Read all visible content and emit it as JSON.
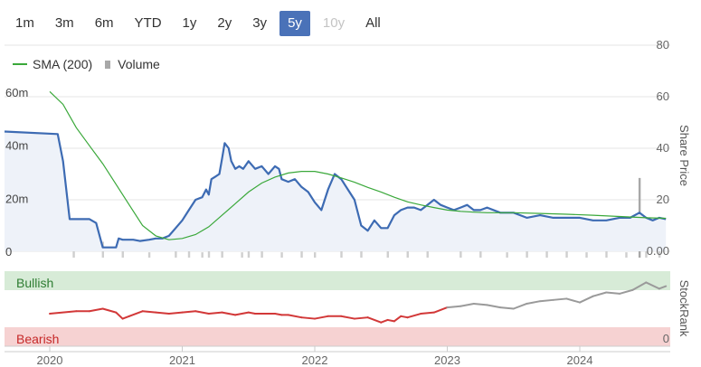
{
  "range_selector": {
    "buttons": [
      {
        "label": "1m",
        "state": "normal"
      },
      {
        "label": "3m",
        "state": "normal"
      },
      {
        "label": "6m",
        "state": "normal"
      },
      {
        "label": "YTD",
        "state": "normal"
      },
      {
        "label": "1y",
        "state": "normal"
      },
      {
        "label": "2y",
        "state": "normal"
      },
      {
        "label": "3y",
        "state": "normal"
      },
      {
        "label": "5y",
        "state": "active"
      },
      {
        "label": "10y",
        "state": "disabled"
      },
      {
        "label": "All",
        "state": "normal"
      }
    ]
  },
  "legend": {
    "sma_label": "SMA (200)",
    "volume_label": "Volume"
  },
  "colors": {
    "price_line": "#3d6bb3",
    "price_fill": "#eef2f9",
    "sma_line": "#3aa83a",
    "volume_bar": "#cfcfcf",
    "volume_spike": "#a8a8a8",
    "bullish_fill": "#d7ebd7",
    "bearish_fill": "#f6d2d2",
    "bullish_text": "#2e7d32",
    "bearish_text": "#c62828",
    "rank_red": "#d23838",
    "rank_grey": "#9a9a9a",
    "active_button": "#4a72b8"
  },
  "chart_data": {
    "type": "line",
    "x_labels": [
      "2020",
      "2021",
      "2022",
      "2023",
      "2024"
    ],
    "price_axis": {
      "title": "Share Price",
      "ticks": [
        "80",
        "60",
        "40",
        "20",
        "0.00"
      ],
      "ylim": [
        0,
        80
      ]
    },
    "volume_axis": {
      "ticks": [
        "60m",
        "40m",
        "20m",
        "0"
      ],
      "ylim": [
        0,
        80
      ]
    },
    "rank_axis": {
      "title": "StockRank",
      "ticks": [
        "0"
      ]
    },
    "zones": {
      "bullish_label": "Bullish",
      "bearish_label": "Bearish"
    },
    "series": [
      {
        "name": "Share Price",
        "x": [
          0,
          0.06,
          0.1,
          0.15,
          0.2,
          0.22,
          0.25,
          0.3,
          0.35,
          0.4,
          0.5,
          0.52,
          0.55,
          0.6,
          0.63,
          0.68,
          0.75,
          0.8,
          0.85,
          0.9,
          0.95,
          1.0,
          1.05,
          1.1,
          1.15,
          1.18,
          1.2,
          1.22,
          1.25,
          1.28,
          1.3,
          1.32,
          1.35,
          1.37,
          1.4,
          1.43,
          1.46,
          1.5,
          1.55,
          1.6,
          1.65,
          1.7,
          1.73,
          1.75,
          1.8,
          1.85,
          1.9,
          1.95,
          2.0,
          2.05,
          2.1,
          2.15,
          2.2,
          2.25,
          2.3,
          2.35,
          2.4,
          2.45,
          2.5,
          2.55,
          2.6,
          2.65,
          2.7,
          2.75,
          2.8,
          2.85,
          2.9,
          2.95,
          3.0,
          3.05,
          3.1,
          3.15,
          3.2,
          3.25,
          3.3,
          3.4,
          3.5,
          3.6,
          3.7,
          3.8,
          3.9,
          4.0,
          4.1,
          4.2,
          4.3,
          4.38,
          4.45,
          4.5,
          4.55,
          4.6,
          4.65
        ],
        "values": [
          46.5,
          45.5,
          35,
          12.5,
          12.5,
          12.5,
          12.5,
          12.5,
          11,
          1.5,
          1.5,
          5,
          4.5,
          4.5,
          4.5,
          4,
          4.5,
          5,
          5,
          6,
          9,
          12,
          16,
          20,
          21,
          24,
          22,
          28,
          29,
          30,
          36,
          42,
          40,
          35,
          32,
          33,
          32,
          35,
          32,
          33,
          30,
          33,
          32,
          28,
          27,
          28,
          25,
          23,
          19,
          16,
          24,
          30,
          28,
          24,
          20,
          10,
          8,
          12,
          9,
          9,
          14,
          16,
          17,
          17,
          16,
          18,
          20,
          18,
          17,
          16,
          17,
          18,
          16,
          16,
          17,
          15,
          15,
          13,
          14,
          13,
          13,
          13,
          12,
          12,
          13,
          13,
          15,
          13,
          12,
          13,
          12.5
        ]
      },
      {
        "name": "SMA (200)",
        "x": [
          0,
          0.1,
          0.2,
          0.3,
          0.4,
          0.5,
          0.6,
          0.7,
          0.8,
          0.9,
          1.0,
          1.1,
          1.2,
          1.3,
          1.4,
          1.5,
          1.6,
          1.7,
          1.8,
          1.9,
          2.0,
          2.1,
          2.2,
          2.3,
          2.4,
          2.5,
          2.6,
          2.7,
          2.8,
          2.9,
          3.0,
          3.1,
          3.2,
          3.3,
          3.5,
          3.7,
          3.9,
          4.1,
          4.3,
          4.5,
          4.65
        ],
        "values": [
          62,
          57,
          48,
          41,
          34,
          26,
          18,
          10,
          6,
          4.5,
          5,
          6.5,
          9.5,
          14,
          18.5,
          23,
          26.5,
          28.8,
          30.4,
          31,
          31,
          30,
          28.5,
          26.8,
          24.8,
          23,
          21,
          19.2,
          18,
          17,
          16,
          15.5,
          15.2,
          15,
          15,
          14.7,
          14.4,
          14,
          13.5,
          13,
          12.8
        ]
      },
      {
        "name": "Volume",
        "x": [
          0.18,
          0.4,
          0.55,
          0.75,
          0.95,
          1.05,
          1.15,
          1.2,
          1.3,
          1.45,
          1.5,
          1.6,
          1.75,
          1.9,
          2.0,
          2.2,
          2.35,
          2.55,
          2.7,
          2.85,
          3.1,
          3.25,
          3.45,
          3.6,
          3.75,
          3.9,
          4.05,
          4.2,
          4.35,
          4.45,
          4.5,
          4.6
        ],
        "values": [
          4,
          6,
          3,
          2,
          4,
          3,
          2,
          5,
          3,
          2,
          4,
          3,
          2,
          3,
          2,
          5,
          4,
          6,
          3,
          5,
          3,
          4,
          2,
          3,
          5,
          3,
          2,
          3,
          2,
          30,
          7,
          3
        ]
      },
      {
        "name": "StockRank",
        "x": [
          0,
          0.2,
          0.3,
          0.4,
          0.5,
          0.55,
          0.6,
          0.7,
          0.8,
          0.9,
          1.0,
          1.1,
          1.2,
          1.3,
          1.4,
          1.5,
          1.55,
          1.6,
          1.7,
          1.75,
          1.8,
          1.9,
          2.0,
          2.1,
          2.2,
          2.3,
          2.4,
          2.5,
          2.55,
          2.6,
          2.65,
          2.7,
          2.8,
          2.9,
          3.0,
          3.1,
          3.2,
          3.3,
          3.4,
          3.5,
          3.6,
          3.7,
          3.8,
          3.9,
          4.0,
          4.1,
          4.2,
          4.3,
          4.4,
          4.5,
          4.6,
          4.65
        ],
        "values": [
          26,
          28,
          28,
          30,
          27,
          22,
          24,
          28,
          27,
          26,
          27,
          28,
          26,
          27,
          25,
          27,
          26,
          26,
          26,
          25,
          25,
          23,
          22,
          24,
          24,
          22,
          23,
          19,
          21,
          20,
          24,
          23,
          26,
          27,
          31,
          32,
          34,
          33,
          31,
          30,
          34,
          36,
          37,
          38,
          35,
          40,
          43,
          42,
          45,
          51,
          46,
          48
        ]
      }
    ]
  }
}
